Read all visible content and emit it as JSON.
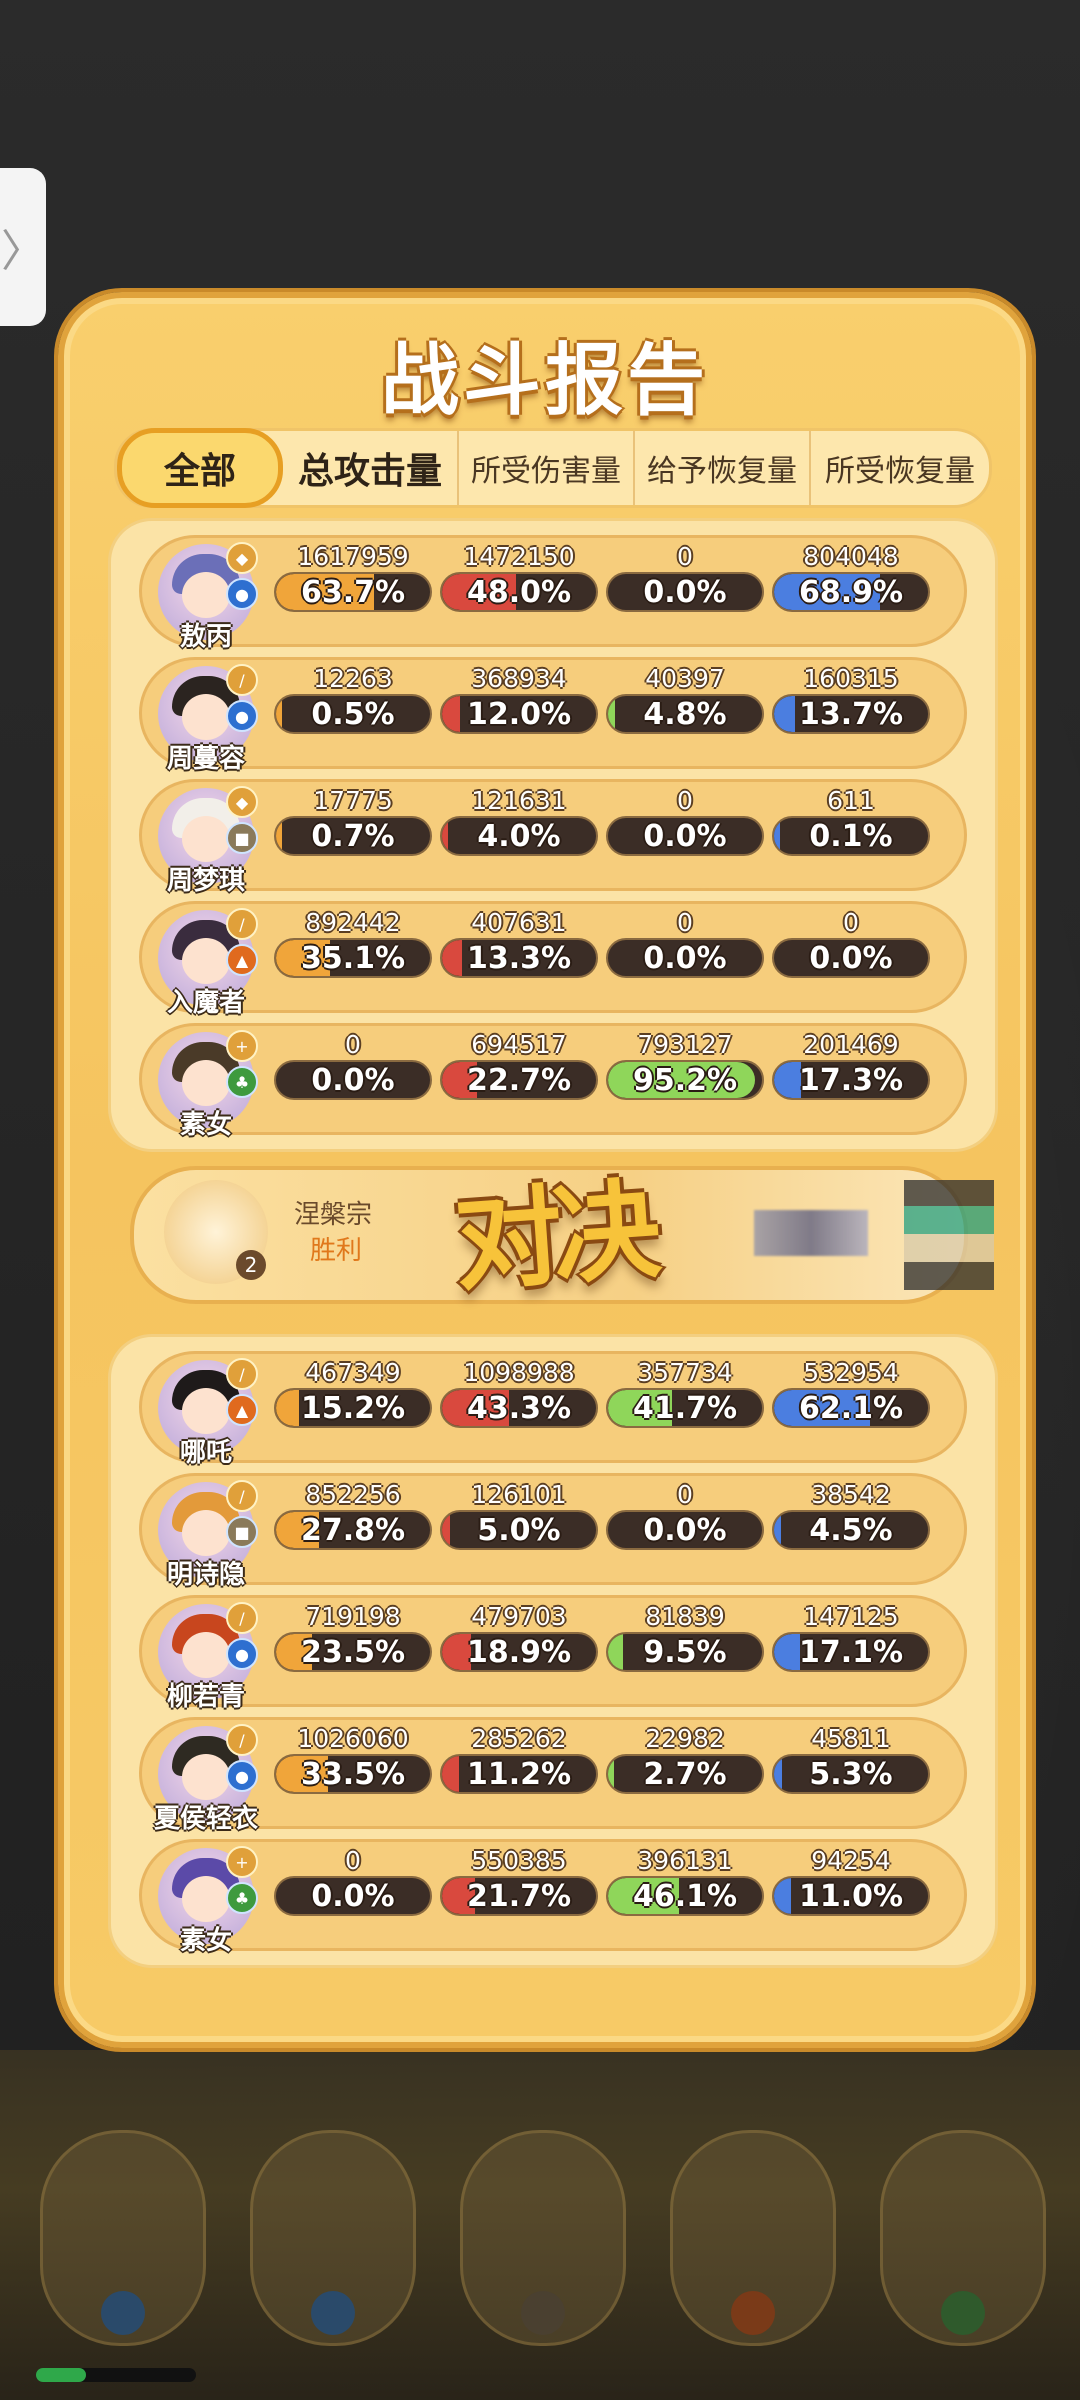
{
  "side_tab": {
    "glyph": "〉"
  },
  "title": "战斗报告",
  "tabs": [
    "全部",
    "总攻击量",
    "所受伤害量",
    "给予恢复量",
    "所受恢复量"
  ],
  "bar_colors": {
    "attack": "#f0a53a",
    "damage_taken": "#d9493e",
    "heal_given": "#8fd65a",
    "heal_received": "#4b7ee0"
  },
  "team_a": [
    {
      "name": "敖丙",
      "role_icon": "shield-icon",
      "element_icon": "water-icon",
      "stats": [
        {
          "value": "1617959",
          "pct": "63.7%",
          "fill": 0.637
        },
        {
          "value": "1472150",
          "pct": "48.0%",
          "fill": 0.48
        },
        {
          "value": "0",
          "pct": "0.0%",
          "fill": 0
        },
        {
          "value": "804048",
          "pct": "68.9%",
          "fill": 0.689
        }
      ]
    },
    {
      "name": "周蔓容",
      "role_icon": "sword-icon",
      "element_icon": "water-icon",
      "stats": [
        {
          "value": "12263",
          "pct": "0.5%",
          "fill": 0.005
        },
        {
          "value": "368934",
          "pct": "12.0%",
          "fill": 0.12
        },
        {
          "value": "40397",
          "pct": "4.8%",
          "fill": 0.048
        },
        {
          "value": "160315",
          "pct": "13.7%",
          "fill": 0.137
        }
      ]
    },
    {
      "name": "周梦琪",
      "role_icon": "shield-icon",
      "element_icon": "earth-icon",
      "stats": [
        {
          "value": "17775",
          "pct": "0.7%",
          "fill": 0.007
        },
        {
          "value": "121631",
          "pct": "4.0%",
          "fill": 0.04
        },
        {
          "value": "0",
          "pct": "0.0%",
          "fill": 0
        },
        {
          "value": "611",
          "pct": "0.1%",
          "fill": 0.001
        }
      ]
    },
    {
      "name": "入魔者",
      "role_icon": "sword-icon",
      "element_icon": "fire-icon",
      "stats": [
        {
          "value": "892442",
          "pct": "35.1%",
          "fill": 0.351
        },
        {
          "value": "407631",
          "pct": "13.3%",
          "fill": 0.133
        },
        {
          "value": "0",
          "pct": "0.0%",
          "fill": 0
        },
        {
          "value": "0",
          "pct": "0.0%",
          "fill": 0
        }
      ]
    },
    {
      "name": "素女",
      "role_icon": "heal-icon",
      "element_icon": "wood-icon",
      "stats": [
        {
          "value": "0",
          "pct": "0.0%",
          "fill": 0
        },
        {
          "value": "694517",
          "pct": "22.7%",
          "fill": 0.227
        },
        {
          "value": "793127",
          "pct": "95.2%",
          "fill": 0.952
        },
        {
          "value": "201469",
          "pct": "17.3%",
          "fill": 0.173
        }
      ]
    }
  ],
  "versus": {
    "sect": "涅槃宗",
    "result": "胜利",
    "rank": "2",
    "vs_text": "对决"
  },
  "team_b": [
    {
      "name": "哪吒",
      "role_icon": "sword-icon",
      "element_icon": "fire-icon",
      "stats": [
        {
          "value": "467349",
          "pct": "15.2%",
          "fill": 0.152
        },
        {
          "value": "1098988",
          "pct": "43.3%",
          "fill": 0.433
        },
        {
          "value": "357734",
          "pct": "41.7%",
          "fill": 0.417
        },
        {
          "value": "532954",
          "pct": "62.1%",
          "fill": 0.621
        }
      ]
    },
    {
      "name": "明诗隐",
      "role_icon": "sword-icon",
      "element_icon": "earth-icon",
      "stats": [
        {
          "value": "852256",
          "pct": "27.8%",
          "fill": 0.278
        },
        {
          "value": "126101",
          "pct": "5.0%",
          "fill": 0.05
        },
        {
          "value": "0",
          "pct": "0.0%",
          "fill": 0
        },
        {
          "value": "38542",
          "pct": "4.5%",
          "fill": 0.045
        }
      ]
    },
    {
      "name": "柳若青",
      "role_icon": "sword-icon",
      "element_icon": "water-icon",
      "stats": [
        {
          "value": "719198",
          "pct": "23.5%",
          "fill": 0.235
        },
        {
          "value": "479703",
          "pct": "18.9%",
          "fill": 0.189
        },
        {
          "value": "81839",
          "pct": "9.5%",
          "fill": 0.095
        },
        {
          "value": "147125",
          "pct": "17.1%",
          "fill": 0.171
        }
      ]
    },
    {
      "name": "夏侯轻衣",
      "role_icon": "sword-icon",
      "element_icon": "water-icon",
      "stats": [
        {
          "value": "1026060",
          "pct": "33.5%",
          "fill": 0.335
        },
        {
          "value": "285262",
          "pct": "11.2%",
          "fill": 0.112
        },
        {
          "value": "22982",
          "pct": "2.7%",
          "fill": 0.027
        },
        {
          "value": "45811",
          "pct": "5.3%",
          "fill": 0.053
        }
      ]
    },
    {
      "name": "素女",
      "role_icon": "heal-icon",
      "element_icon": "wood-icon",
      "stats": [
        {
          "value": "0",
          "pct": "0.0%",
          "fill": 0
        },
        {
          "value": "550385",
          "pct": "21.7%",
          "fill": 0.217
        },
        {
          "value": "396131",
          "pct": "46.1%",
          "fill": 0.461
        },
        {
          "value": "94254",
          "pct": "11.0%",
          "fill": 0.11
        }
      ]
    }
  ]
}
